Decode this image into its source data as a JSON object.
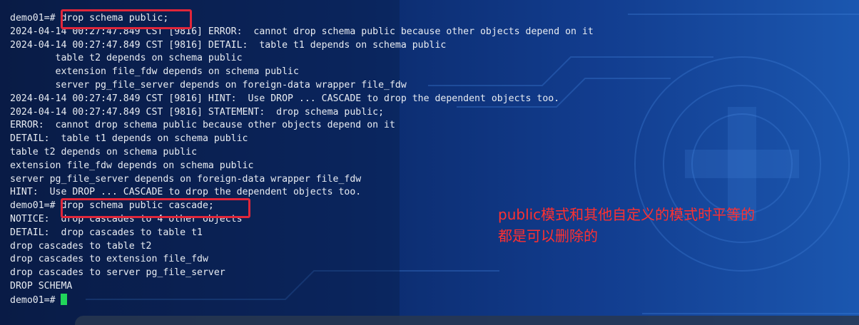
{
  "terminal": {
    "lines": [
      "demo01=# drop schema public;",
      "2024-04-14 00:27:47.849 CST [9816] ERROR:  cannot drop schema public because other objects depend on it",
      "2024-04-14 00:27:47.849 CST [9816] DETAIL:  table t1 depends on schema public",
      "        table t2 depends on schema public",
      "        extension file_fdw depends on schema public",
      "        server pg_file_server depends on foreign-data wrapper file_fdw",
      "2024-04-14 00:27:47.849 CST [9816] HINT:  Use DROP ... CASCADE to drop the dependent objects too.",
      "2024-04-14 00:27:47.849 CST [9816] STATEMENT:  drop schema public;",
      "ERROR:  cannot drop schema public because other objects depend on it",
      "DETAIL:  table t1 depends on schema public",
      "table t2 depends on schema public",
      "extension file_fdw depends on schema public",
      "server pg_file_server depends on foreign-data wrapper file_fdw",
      "HINT:  Use DROP ... CASCADE to drop the dependent objects too.",
      "demo01=# drop schema public cascade;",
      "NOTICE:  drop cascades to 4 other objects",
      "DETAIL:  drop cascades to table t1",
      "drop cascades to table t2",
      "drop cascades to extension file_fdw",
      "drop cascades to server pg_file_server",
      "DROP SCHEMA"
    ],
    "prompt": "demo01=# "
  },
  "annotation": {
    "line1": "public模式和其他自定义的模式时平等的",
    "line2": "都是可以删除的"
  },
  "colors": {
    "text": "#e8ecf2",
    "highlight_box": "#e0263a",
    "annotation": "#ff3030",
    "cursor": "#21d65a"
  }
}
